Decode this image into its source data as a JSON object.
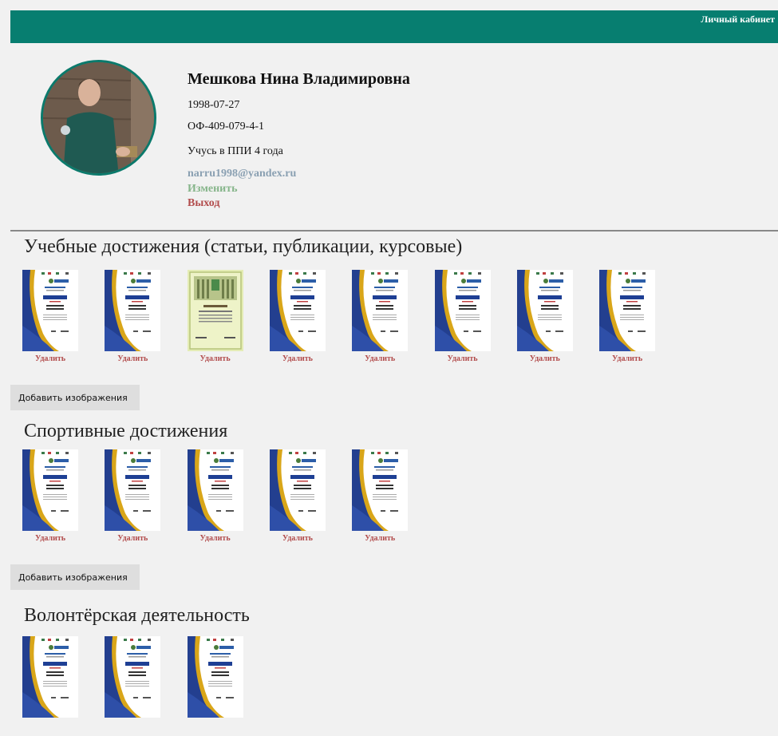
{
  "header": {
    "cabinet_link": "Личный кабинет",
    "color": "#077e70"
  },
  "profile": {
    "name": "Мешкова Нина Владимировна",
    "birthdate": "1998-07-27",
    "code": "ОФ-409-079-4-1",
    "study": "Учусь в ППИ 4 года",
    "email": "narru1998@yandex.ru",
    "edit_label": "Изменить",
    "logout_label": "Выход"
  },
  "sections": [
    {
      "title": "Учебные достижения (статьи, публикации, курсовые)",
      "items": [
        {
          "kind": "certificate",
          "delete_label": "Удалить"
        },
        {
          "kind": "certificate",
          "delete_label": "Удалить"
        },
        {
          "kind": "diploma",
          "delete_label": "Удалить"
        },
        {
          "kind": "certificate",
          "delete_label": "Удалить"
        },
        {
          "kind": "certificate",
          "delete_label": "Удалить"
        },
        {
          "kind": "certificate",
          "delete_label": "Удалить"
        },
        {
          "kind": "certificate",
          "delete_label": "Удалить"
        },
        {
          "kind": "certificate",
          "delete_label": "Удалить"
        }
      ],
      "add_label": "Добавить изображения"
    },
    {
      "title": "Спортивные достижения",
      "items": [
        {
          "kind": "certificate",
          "delete_label": "Удалить"
        },
        {
          "kind": "certificate",
          "delete_label": "Удалить"
        },
        {
          "kind": "certificate",
          "delete_label": "Удалить"
        },
        {
          "kind": "certificate",
          "delete_label": "Удалить"
        },
        {
          "kind": "certificate",
          "delete_label": "Удалить"
        }
      ],
      "add_label": "Добавить изображения"
    },
    {
      "title": "Волонтёрская деятельность",
      "items": [
        {
          "kind": "certificate"
        },
        {
          "kind": "certificate"
        },
        {
          "kind": "certificate"
        }
      ]
    }
  ]
}
